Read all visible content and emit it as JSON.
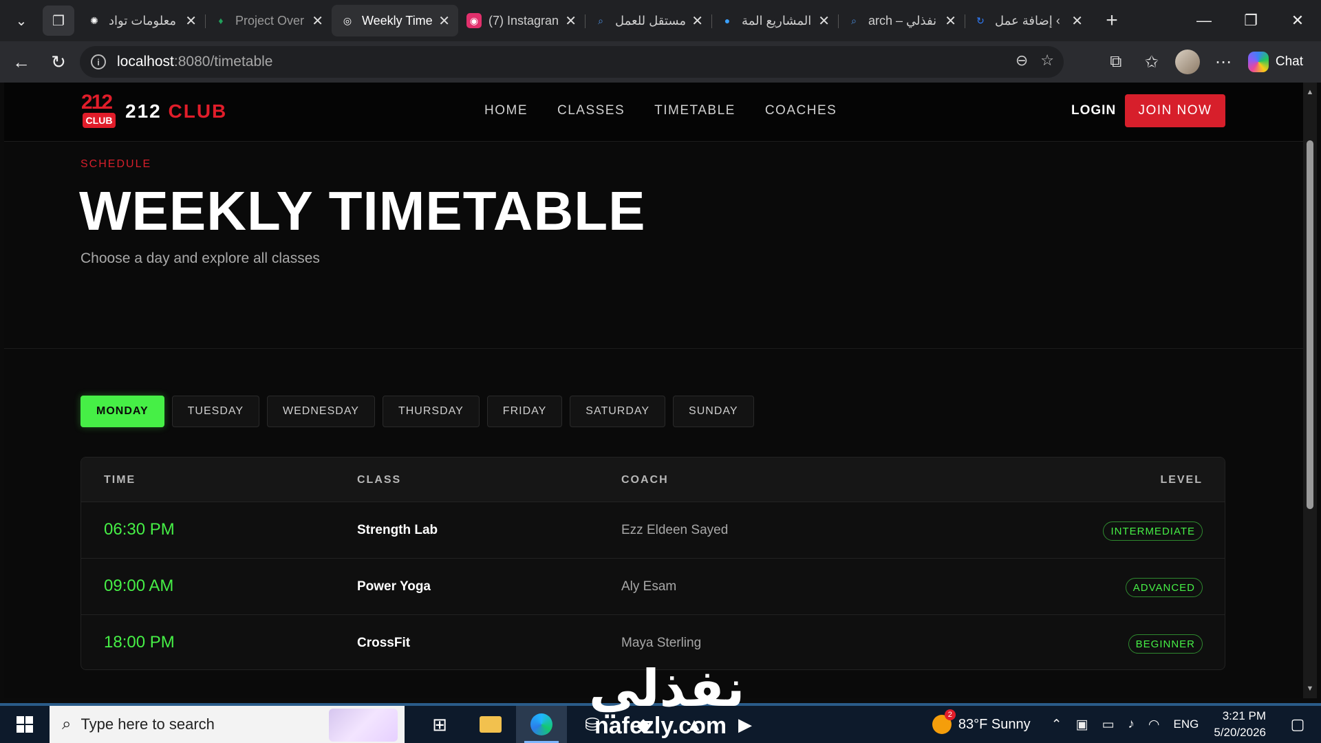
{
  "browser": {
    "tabs": [
      {
        "title": "معلومات تواد",
        "icon": "chatgpt-icon",
        "color": "#ffffff",
        "active": false
      },
      {
        "title": "Project Over",
        "icon": "leaf-icon",
        "color": "#21a05b",
        "active": false
      },
      {
        "title": "Weekly Time",
        "icon": "globe-icon",
        "color": "#ffffff",
        "active": true
      },
      {
        "title": "(7) Instagran",
        "icon": "instagram-icon",
        "color": "#e1306c",
        "active": false
      },
      {
        "title": "مستقل للعمل",
        "icon": "search-icon",
        "color": "#4a90e2",
        "active": false
      },
      {
        "title": "المشاريع المة",
        "icon": "circle-icon",
        "color": "#3aa0ff",
        "active": false
      },
      {
        "title": "arch – نفذلي",
        "icon": "search-icon",
        "color": "#4a90e2",
        "active": false
      },
      {
        "title": "إضافة عمل ‹",
        "icon": "refresh-icon",
        "color": "#2f7dff",
        "active": false
      }
    ],
    "url_host": "localhost",
    "url_path": ":8080/timetable",
    "chat_label": "Chat"
  },
  "site": {
    "logo_number": "212",
    "logo_badge": "CLUB",
    "logo_name": "212",
    "logo_name_accent": "CLUB",
    "nav": [
      "HOME",
      "CLASSES",
      "TIMETABLE",
      "COACHES"
    ],
    "login": "LOGIN",
    "join": "JOIN NOW"
  },
  "hero": {
    "eyebrow": "SCHEDULE",
    "title": "WEEKLY TIMETABLE",
    "subtitle": "Choose a day and explore all classes"
  },
  "days": [
    "MONDAY",
    "TUESDAY",
    "WEDNESDAY",
    "THURSDAY",
    "FRIDAY",
    "SATURDAY",
    "SUNDAY"
  ],
  "selected_day": "MONDAY",
  "table": {
    "headers": {
      "time": "TIME",
      "class": "CLASS",
      "coach": "COACH",
      "level": "LEVEL"
    },
    "rows": [
      {
        "time": "06:30 PM",
        "class": "Strength Lab",
        "coach": "Ezz Eldeen Sayed",
        "level": "INTERMEDIATE"
      },
      {
        "time": "09:00 AM",
        "class": "Power Yoga",
        "coach": "Aly Esam",
        "level": "ADVANCED"
      },
      {
        "time": "18:00 PM",
        "class": "CrossFit",
        "coach": "Maya Sterling",
        "level": "BEGINNER"
      }
    ]
  },
  "watermark": {
    "arabic": "نفذلي",
    "latin": "nafezly.com"
  },
  "taskbar": {
    "search_placeholder": "Type here to search",
    "weather_badge": "2",
    "weather": "83°F  Sunny",
    "lang": "ENG",
    "time": "3:21 PM",
    "date": "5/20/2026"
  },
  "colors": {
    "accent_red": "#d71f2b",
    "accent_green": "#46ef46",
    "background": "#0a0a0a"
  }
}
